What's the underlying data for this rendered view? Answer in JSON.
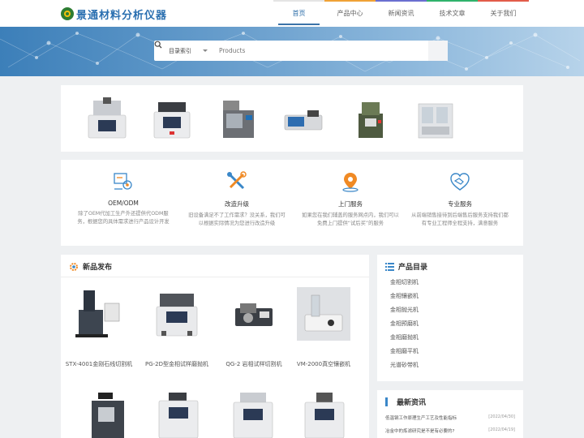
{
  "header": {
    "logo_text": "景通材料分析仪器",
    "nav": [
      {
        "label": "首页",
        "bar_color": "#e0e0e0",
        "active": true
      },
      {
        "label": "产品中心",
        "bar_color": "#f0a236"
      },
      {
        "label": "新闻资讯",
        "bar_color": "#6a6fd0"
      },
      {
        "label": "技术文章",
        "bar_color": "#2fb36b"
      },
      {
        "label": "关于我们",
        "bar_color": "#e25c4a"
      }
    ]
  },
  "search": {
    "category_label": "目录索引",
    "placeholder": "Products"
  },
  "services": [
    {
      "title": "OEM/ODM",
      "desc": "除了OEM代加工生产外还提供代ODM服务，根据您的具体需求进行产品设计开发",
      "icon": "gear-screen-icon"
    },
    {
      "title": "改造升级",
      "desc": "旧设备满足不了工作需求？没关系，我们可以根据实际情况为您进行改造升级",
      "icon": "tools-icon"
    },
    {
      "title": "上门服务",
      "desc": "如果您在我们辅盖的服务网点内，我们可以免费上门提供“试后买”的服务",
      "icon": "map-pin-icon"
    },
    {
      "title": "专业服务",
      "desc": "从前端销售接待到后端售后服务支持我们都有专业工程师全程支持，满意服务",
      "icon": "handshake-icon"
    }
  ],
  "new_products": {
    "title": "新品发布",
    "items": [
      {
        "name": "STX-4001金刚石线切割机"
      },
      {
        "name": "PG-2D型金相试样磨抛机"
      },
      {
        "name": "QG-2 岩相试样切割机"
      },
      {
        "name": "VM-2000真空镶嵌机"
      }
    ]
  },
  "catalog": {
    "title": "产品目录",
    "items": [
      "金相切割机",
      "金相镶嵌机",
      "金相抛光机",
      "金相预磨机",
      "金相磨抛机",
      "金相磨平机",
      "光谱砂带机"
    ]
  },
  "news": {
    "title": "最新资讯",
    "items": [
      {
        "title": "低温钢工作原理生产工艺及性能指标",
        "date": "[2022/04/30]"
      },
      {
        "title": "冶金中的炼滤研究是不是有必要的?",
        "date": "[2022/04/19]"
      }
    ]
  },
  "colors": {
    "accent": "#2c6ea8",
    "icon_blue": "#3a87c8",
    "icon_orange": "#f08a24"
  }
}
